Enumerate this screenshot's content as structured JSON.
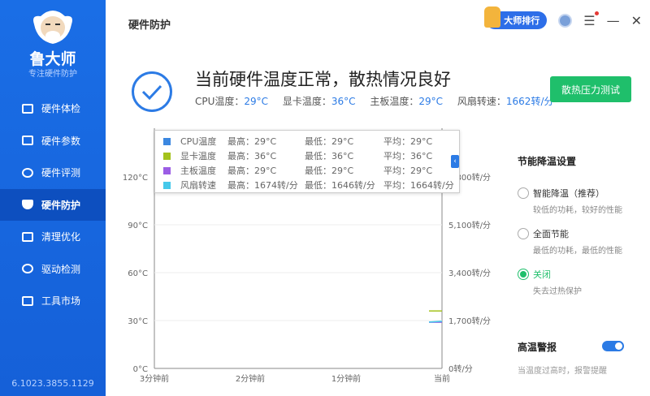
{
  "sidebar": {
    "brand": "鲁大师",
    "slogan": "专注硬件防护",
    "version": "6.1023.3855.1129",
    "items": [
      {
        "label": "硬件体检"
      },
      {
        "label": "硬件参数"
      },
      {
        "label": "硬件评测"
      },
      {
        "label": "硬件防护"
      },
      {
        "label": "清理优化"
      },
      {
        "label": "驱动检测"
      },
      {
        "label": "工具市场"
      }
    ]
  },
  "header": {
    "title": "硬件防护",
    "rank_label": "大师排行"
  },
  "status": {
    "headline": "当前硬件温度正常，散热情况良好",
    "stats": [
      {
        "label": "CPU温度：",
        "value": "29°C"
      },
      {
        "label": "显卡温度：",
        "value": "36°C"
      },
      {
        "label": "主板温度：",
        "value": "29°C"
      },
      {
        "label": "风扇转速：",
        "value": "1662转/分"
      }
    ],
    "stress_button": "散热压力测试"
  },
  "legend": [
    {
      "name": "CPU温度",
      "max": "最高：29°C",
      "min": "最低：29°C",
      "avg": "平均：29°C",
      "color": "#3b87e0"
    },
    {
      "name": "显卡温度",
      "max": "最高：36°C",
      "min": "最低：36°C",
      "avg": "平均：36°C",
      "color": "#a4c21c"
    },
    {
      "name": "主板温度",
      "max": "最高：29°C",
      "min": "最低：29°C",
      "avg": "平均：29°C",
      "color": "#9b5de5"
    },
    {
      "name": "风扇转速",
      "max": "最高：1674转/分",
      "min": "最低：1646转/分",
      "avg": "平均：1664转/分",
      "color": "#45c8ea"
    }
  ],
  "chart_data": {
    "type": "line",
    "x_ticks": [
      "3分钟前",
      "2分钟前",
      "1分钟前",
      "当前"
    ],
    "y_left_ticks": [
      "0°C",
      "30°C",
      "60°C",
      "90°C",
      "120°C"
    ],
    "ylim_left": [
      0,
      120
    ],
    "y_right_ticks": [
      "0转/分",
      "1,700转/分",
      "3,400转/分",
      "5,100转/分",
      "6,800转/分"
    ],
    "ylim_right": [
      0,
      6800
    ],
    "series": [
      {
        "name": "CPU温度",
        "axis": "left",
        "values": [
          29,
          29
        ],
        "color": "#3b87e0"
      },
      {
        "name": "显卡温度",
        "axis": "left",
        "values": [
          36,
          36
        ],
        "color": "#a4c21c"
      },
      {
        "name": "主板温度",
        "axis": "left",
        "values": [
          29,
          29
        ],
        "color": "#9b5de5"
      },
      {
        "name": "风扇转速",
        "axis": "right",
        "values": [
          1646,
          1674
        ],
        "color": "#45c8ea"
      }
    ]
  },
  "settings": {
    "title": "节能降温设置",
    "options": [
      {
        "label": "智能降温（推荐）",
        "desc": "较低的功耗，较好的性能",
        "selected": false
      },
      {
        "label": "全面节能",
        "desc": "最低的功耗，最低的性能",
        "selected": false
      },
      {
        "label": "关闭",
        "desc": "失去过热保护",
        "selected": true
      }
    ],
    "alarm_title": "高温警报",
    "alarm_desc": "当温度过高时，报警提醒",
    "alarm_on": true
  }
}
